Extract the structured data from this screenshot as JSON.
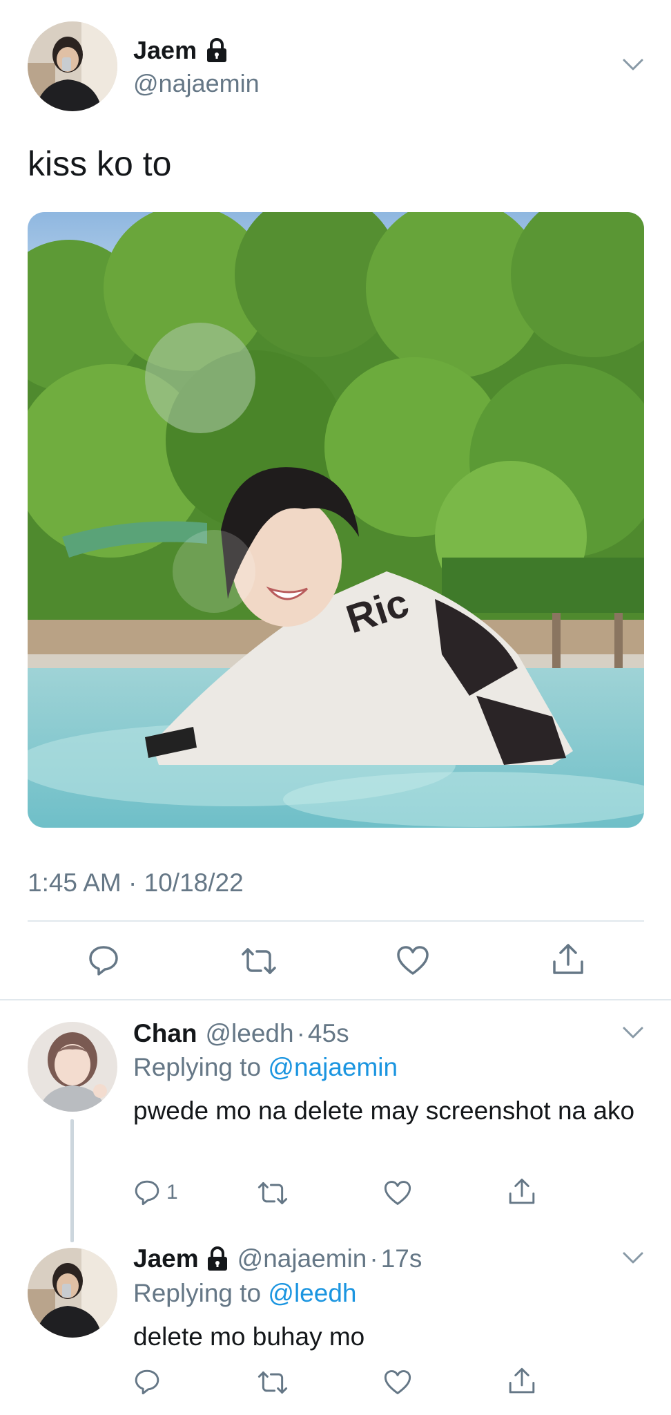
{
  "main_tweet": {
    "author_name": "Jaem",
    "author_handle": "@najaemin",
    "locked_icon": "lock-icon",
    "text": "kiss ko to",
    "timestamp": "1:45 AM · 10/18/22",
    "actions": [
      "reply-icon",
      "retweet-icon",
      "like-icon",
      "share-icon"
    ]
  },
  "replies": [
    {
      "author_name": "Chan",
      "author_handle": "@leedh",
      "time": "45s",
      "replying_prefix": "Replying to",
      "replying_to": "@najaemin",
      "text": "pwede mo na delete may screenshot na ako",
      "reply_count": "1"
    },
    {
      "author_name": "Jaem",
      "author_handle": "@najaemin",
      "time": "17s",
      "replying_prefix": "Replying to",
      "replying_to": "@leedh",
      "text": "delete mo buhay mo",
      "reply_count": ""
    }
  ],
  "colors": {
    "text": "#14171a",
    "secondary": "#657786",
    "link": "#1b95e0",
    "divider": "#e1e8ed"
  }
}
